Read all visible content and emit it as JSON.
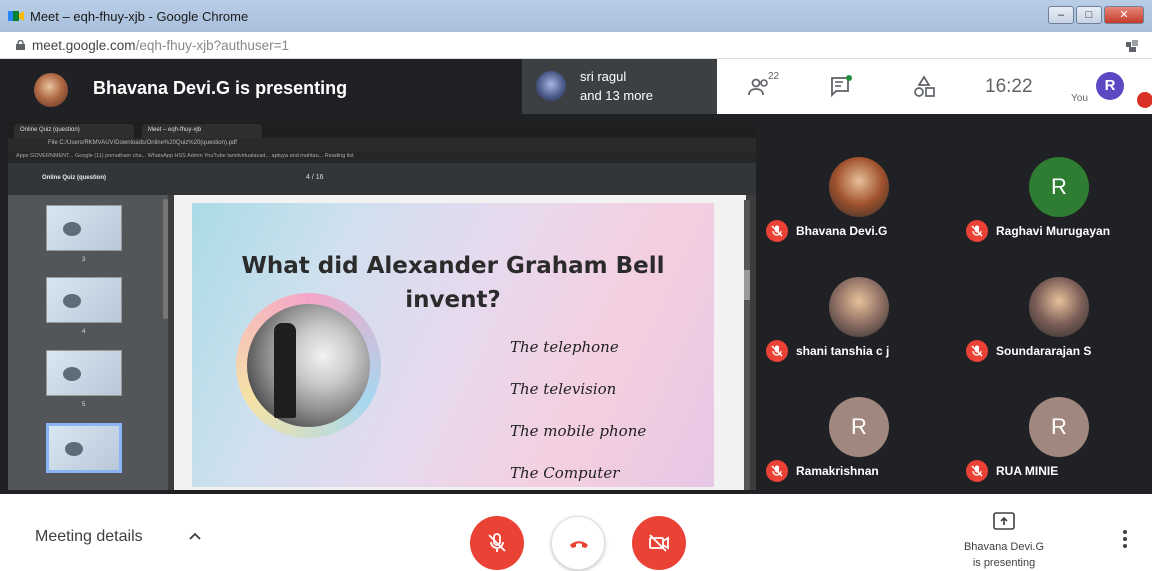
{
  "browser": {
    "window_title": "Meet – eqh-fhuy-xjb - Google Chrome",
    "url_host": "meet.google.com",
    "url_path": "/eqh-fhuy-xjb?authuser=1",
    "win_min": "–",
    "win_max": "□",
    "win_close": "✕"
  },
  "meet_header": {
    "presenter_title": "Bhavana Devi.G is presenting",
    "others_line1": "sri ragul",
    "others_line2": "and 13 more",
    "people_count": "22",
    "clock": "16:22",
    "you_label": "You",
    "you_initial": "R"
  },
  "shared_screen": {
    "inner_tab_1": "Online Quiz (question)",
    "inner_tab_2": "Meet – eqh-fhuy-xjb",
    "inner_address": "File   C:/Users/RKMVAUV/Downloads/Online%20Quiz%20(question).pdf",
    "inner_bookmarks": "Apps   GOVERNMENT...   Google   (11) pomatham cha...   WhatsApp   HSS Admin   YouTube   tamilvirtualacad...   aptuya and mahtau...   Reading list",
    "pdf_title": "Online Quiz (question)",
    "pdf_page": "4 / 16",
    "thumb_numbers": [
      "3",
      "4",
      "5"
    ],
    "slide": {
      "title_line1": "What did Alexander Graham Bell",
      "title_line2": "invent?",
      "options": [
        "The telephone",
        "The television",
        "The mobile phone",
        "The Computer"
      ]
    }
  },
  "participants": [
    {
      "name": "Bhavana Devi.G",
      "initial": "",
      "avatar_color": "#a0522d",
      "photo": true
    },
    {
      "name": "Raghavi Murugayan",
      "initial": "R",
      "avatar_color": "#2e7d32",
      "photo": false
    },
    {
      "name": "shani tanshia c j",
      "initial": "",
      "avatar_color": "#8d6e63",
      "photo": true
    },
    {
      "name": "Soundararajan S",
      "initial": "",
      "avatar_color": "#7b5e57",
      "photo": true
    },
    {
      "name": "Ramakrishnan",
      "initial": "R",
      "avatar_color": "#a1887f",
      "photo": false
    },
    {
      "name": "RUA MINIE",
      "initial": "R",
      "avatar_color": "#a1887f",
      "photo": false
    }
  ],
  "bottom_bar": {
    "meeting_details": "Meeting details",
    "presenting_line1": "Bhavana Devi.G",
    "presenting_line2": "is presenting"
  },
  "colors": {
    "meet_dark": "#202124",
    "end_call_red": "#ea4335",
    "brand_blue": "#1a73e8"
  }
}
